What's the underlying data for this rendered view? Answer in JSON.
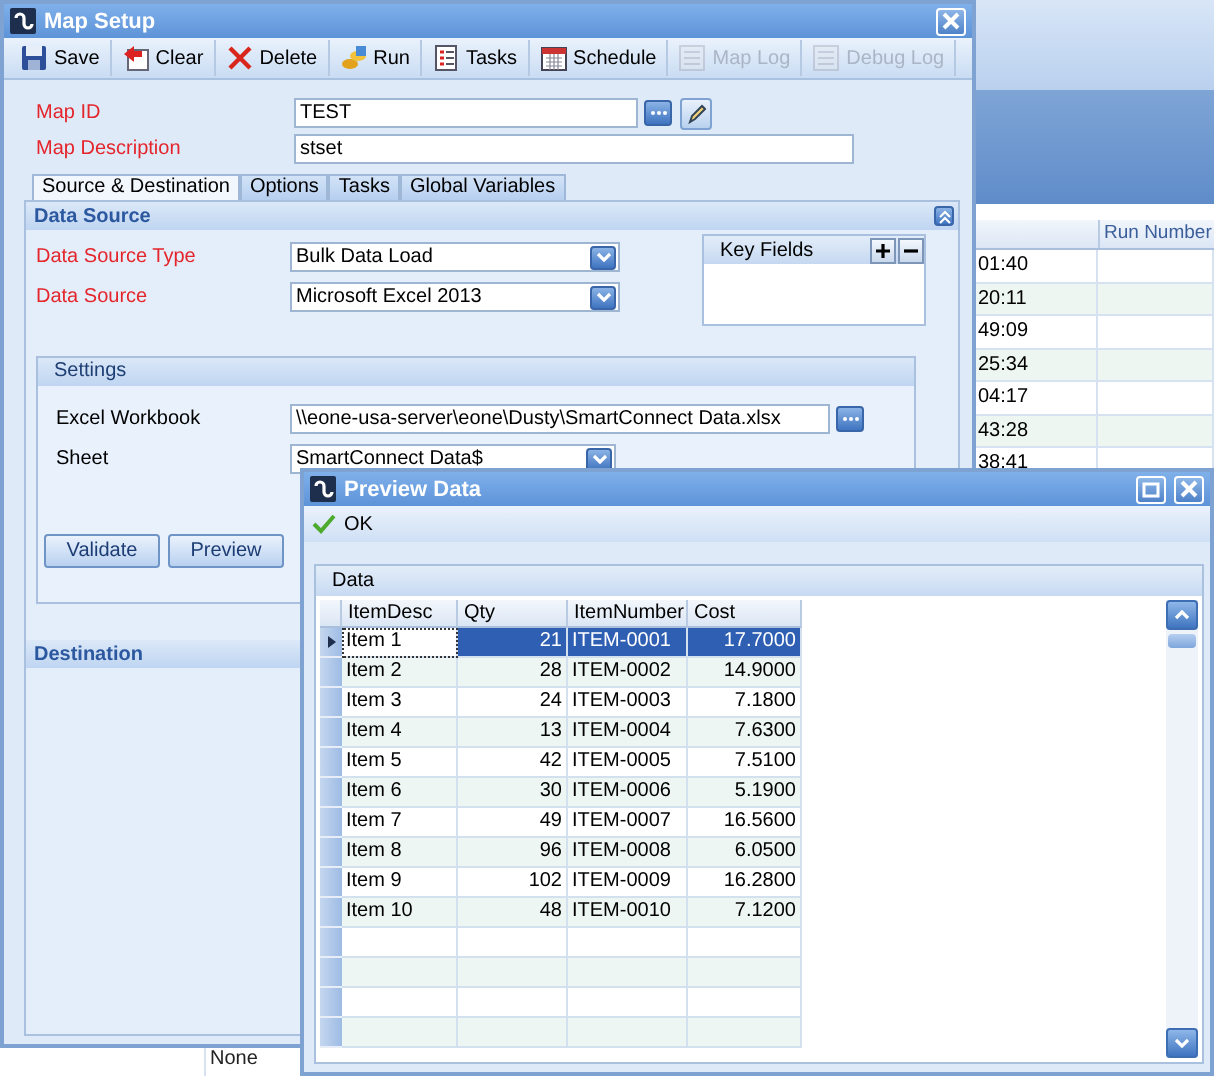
{
  "background_app": {
    "grid": {
      "header": "Run Number",
      "column_1": [
        "01:40",
        "20:11",
        "49:09",
        "25:34",
        "04:17",
        "43:28",
        "38:41"
      ]
    },
    "footer_cell": "None"
  },
  "map_setup": {
    "title": "Map Setup",
    "toolbar": [
      {
        "label": "Save",
        "disabled": false
      },
      {
        "label": "Clear",
        "disabled": false
      },
      {
        "label": "Delete",
        "disabled": false
      },
      {
        "label": "Run",
        "disabled": false
      },
      {
        "label": "Tasks",
        "disabled": false
      },
      {
        "label": "Schedule",
        "disabled": false
      },
      {
        "label": "Map Log",
        "disabled": true
      },
      {
        "label": "Debug Log",
        "disabled": true
      }
    ],
    "fields": [
      {
        "label": "Map ID",
        "value": "TEST",
        "required": true,
        "kind": "lookup"
      },
      {
        "label": "Map Description",
        "value": "stset",
        "required": true,
        "kind": "text"
      }
    ],
    "tabs": [
      {
        "label": "Source & Destination",
        "selected": true
      },
      {
        "label": "Options",
        "selected": false
      },
      {
        "label": "Tasks",
        "selected": false
      },
      {
        "label": "Global Variables",
        "selected": false
      }
    ],
    "data_source": {
      "title": "Data Source",
      "fields": [
        {
          "label": "Data Source Type",
          "value": "Bulk Data Load",
          "required": true,
          "kind": "combo"
        },
        {
          "label": "Data Source",
          "value": "Microsoft Excel 2013",
          "required": true,
          "kind": "combo"
        }
      ],
      "key_fields": {
        "title": "Key Fields"
      },
      "settings": {
        "title": "Settings",
        "fields": [
          {
            "label": "Excel Workbook",
            "value": "\\\\eone-usa-server\\eone\\Dusty\\SmartConnect Data.xlsx",
            "required": false,
            "kind": "browse"
          },
          {
            "label": "Sheet",
            "value": "SmartConnect Data$",
            "required": false,
            "kind": "combo"
          }
        ],
        "buttons": [
          "Validate",
          "Preview"
        ]
      }
    },
    "destination": {
      "title": "Destination"
    }
  },
  "preview": {
    "title": "Preview Data",
    "ok": "OK",
    "group": "Data",
    "columns": [
      "ItemDesc",
      "Qty",
      "ItemNumber",
      "Cost"
    ],
    "rows": [
      {
        "cells": [
          "Item 1",
          "21",
          "ITEM-0001",
          "17.7000"
        ],
        "selected": true
      },
      {
        "cells": [
          "Item 2",
          "28",
          "ITEM-0002",
          "14.9000"
        ],
        "selected": false
      },
      {
        "cells": [
          "Item 3",
          "24",
          "ITEM-0003",
          "7.1800"
        ],
        "selected": false
      },
      {
        "cells": [
          "Item 4",
          "13",
          "ITEM-0004",
          "7.6300"
        ],
        "selected": false
      },
      {
        "cells": [
          "Item 5",
          "42",
          "ITEM-0005",
          "7.5100"
        ],
        "selected": false
      },
      {
        "cells": [
          "Item 6",
          "30",
          "ITEM-0006",
          "5.1900"
        ],
        "selected": false
      },
      {
        "cells": [
          "Item 7",
          "49",
          "ITEM-0007",
          "16.5600"
        ],
        "selected": false
      },
      {
        "cells": [
          "Item 8",
          "96",
          "ITEM-0008",
          "6.0500"
        ],
        "selected": false
      },
      {
        "cells": [
          "Item 9",
          "102",
          "ITEM-0009",
          "16.2800"
        ],
        "selected": false
      },
      {
        "cells": [
          "Item 10",
          "48",
          "ITEM-0010",
          "7.1200"
        ],
        "selected": false
      }
    ]
  }
}
